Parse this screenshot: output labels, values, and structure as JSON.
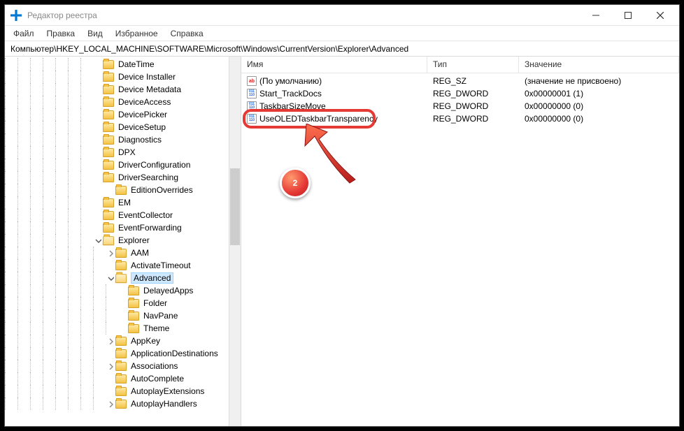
{
  "window": {
    "title": "Редактор реестра"
  },
  "menu": {
    "file": "Файл",
    "edit": "Правка",
    "view": "Вид",
    "favorites": "Избранное",
    "help": "Справка"
  },
  "address": "Компьютер\\HKEY_LOCAL_MACHINE\\SOFTWARE\\Microsoft\\Windows\\CurrentVersion\\Explorer\\Advanced",
  "tree": [
    {
      "indent": 7,
      "exp": "",
      "open": false,
      "label": "DateTime"
    },
    {
      "indent": 7,
      "exp": "",
      "open": false,
      "label": "Device Installer"
    },
    {
      "indent": 7,
      "exp": "",
      "open": false,
      "label": "Device Metadata"
    },
    {
      "indent": 7,
      "exp": "",
      "open": false,
      "label": "DeviceAccess"
    },
    {
      "indent": 7,
      "exp": "",
      "open": false,
      "label": "DevicePicker"
    },
    {
      "indent": 7,
      "exp": "",
      "open": false,
      "label": "DeviceSetup"
    },
    {
      "indent": 7,
      "exp": "",
      "open": false,
      "label": "Diagnostics"
    },
    {
      "indent": 7,
      "exp": "",
      "open": false,
      "label": "DPX"
    },
    {
      "indent": 7,
      "exp": "",
      "open": false,
      "label": "DriverConfiguration"
    },
    {
      "indent": 7,
      "exp": "",
      "open": false,
      "label": "DriverSearching"
    },
    {
      "indent": 8,
      "exp": "",
      "open": false,
      "label": "EditionOverrides",
      "guideGap": true
    },
    {
      "indent": 7,
      "exp": "",
      "open": false,
      "label": "EM"
    },
    {
      "indent": 7,
      "exp": "",
      "open": false,
      "label": "EventCollector"
    },
    {
      "indent": 7,
      "exp": "",
      "open": false,
      "label": "EventForwarding"
    },
    {
      "indent": 7,
      "exp": "v",
      "open": true,
      "label": "Explorer"
    },
    {
      "indent": 8,
      "exp": ">",
      "open": false,
      "label": "AAM"
    },
    {
      "indent": 8,
      "exp": "",
      "open": false,
      "label": "ActivateTimeout"
    },
    {
      "indent": 8,
      "exp": "v",
      "open": true,
      "label": "Advanced",
      "selected": true
    },
    {
      "indent": 9,
      "exp": "",
      "open": false,
      "label": "DelayedApps"
    },
    {
      "indent": 9,
      "exp": "",
      "open": false,
      "label": "Folder"
    },
    {
      "indent": 9,
      "exp": "",
      "open": false,
      "label": "NavPane"
    },
    {
      "indent": 9,
      "exp": "",
      "open": false,
      "label": "Theme"
    },
    {
      "indent": 8,
      "exp": ">",
      "open": false,
      "label": "AppKey"
    },
    {
      "indent": 8,
      "exp": "",
      "open": false,
      "label": "ApplicationDestinations"
    },
    {
      "indent": 8,
      "exp": ">",
      "open": false,
      "label": "Associations"
    },
    {
      "indent": 8,
      "exp": "",
      "open": false,
      "label": "AutoComplete"
    },
    {
      "indent": 8,
      "exp": "",
      "open": false,
      "label": "AutoplayExtensions"
    },
    {
      "indent": 8,
      "exp": ">",
      "open": false,
      "label": "AutoplayHandlers"
    }
  ],
  "columns": {
    "name": "Имя",
    "type": "Тип",
    "value": "Значение"
  },
  "values": [
    {
      "icon": "str",
      "name": "(По умолчанию)",
      "type": "REG_SZ",
      "value": "(значение не присвоено)"
    },
    {
      "icon": "dword",
      "name": "Start_TrackDocs",
      "type": "REG_DWORD",
      "value": "0x00000001 (1)"
    },
    {
      "icon": "dword",
      "name": "TaskbarSizeMove",
      "type": "REG_DWORD",
      "value": "0x00000000 (0)"
    },
    {
      "icon": "dword",
      "name": "UseOLEDTaskbarTransparency",
      "type": "REG_DWORD",
      "value": "0x00000000 (0)"
    }
  ],
  "annotation": {
    "step": "2"
  }
}
